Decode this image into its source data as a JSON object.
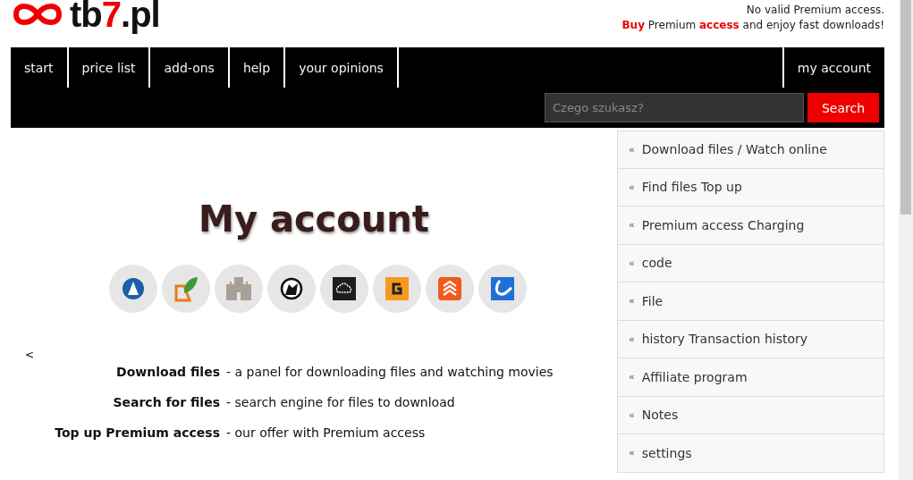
{
  "logo": {
    "text_start": "tb",
    "text_accent": "7",
    "text_end": ".pl"
  },
  "notice": {
    "line_1": "No valid Premium access.",
    "line_2": "**Buy** Premium **access** and enjoy fast downloads!"
  },
  "nav": {
    "items": [
      "start",
      "price list",
      "add-ons",
      "help",
      "your opinions"
    ],
    "account": "my account"
  },
  "search": {
    "placeholder": "Czego szukasz?",
    "button": "Search"
  },
  "sidebar": {
    "items": [
      "Download files / Watch online",
      "Find files Top up",
      "Premium access Charging",
      "code",
      "File",
      "history Transaction history",
      "Affiliate program",
      "Notes",
      "settings"
    ],
    "bullet": "«"
  },
  "main": {
    "title": "My account",
    "back": "<",
    "services": [
      {
        "kind": "sail"
      },
      {
        "kind": "leaf"
      },
      {
        "kind": "castle"
      },
      {
        "kind": "wolf"
      },
      {
        "kind": "cloud"
      },
      {
        "kind": "g"
      },
      {
        "kind": "chevrons"
      },
      {
        "kind": "swirl"
      }
    ],
    "definitions": [
      {
        "term": "Download files",
        "description": "- a panel for downloading files and watching movies"
      },
      {
        "term": "Search for files",
        "description": "- search engine for files to download"
      },
      {
        "term": "Top up Premium access",
        "description": "- our offer with Premium access"
      }
    ]
  }
}
